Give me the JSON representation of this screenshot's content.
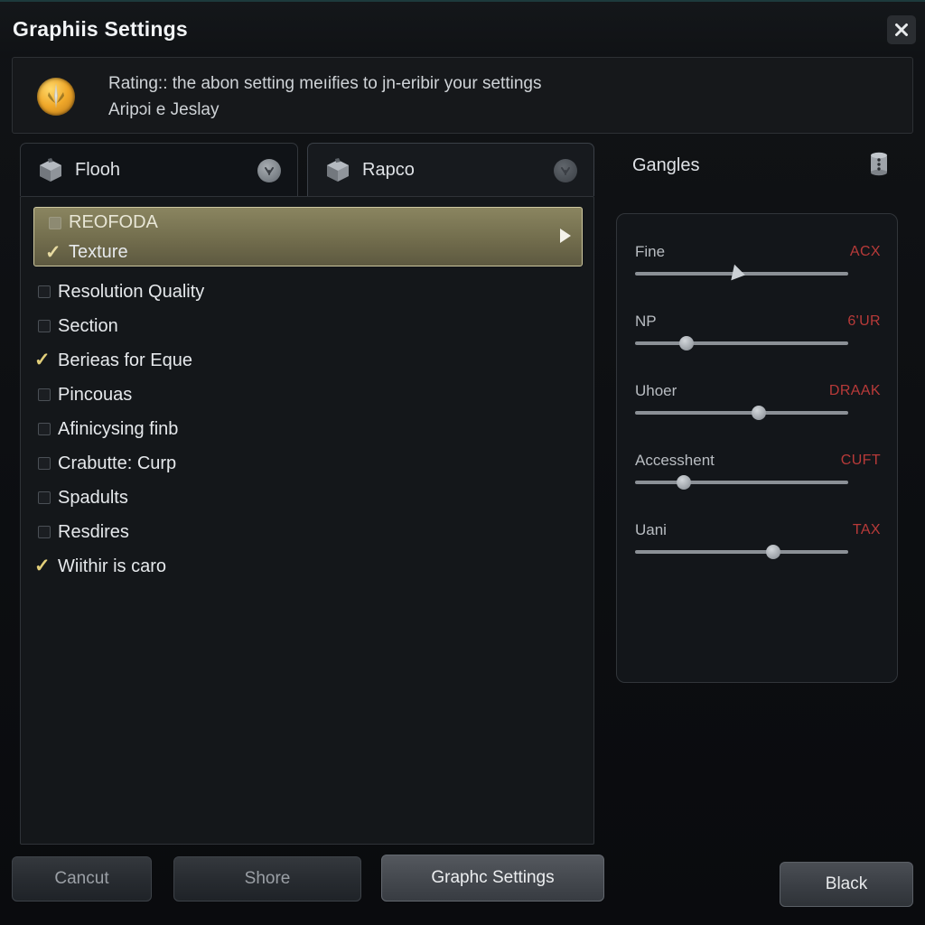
{
  "window": {
    "title": "Graphiis Settings",
    "close_icon": "close-x-icon"
  },
  "banner": {
    "icon": "gold-medal-icon",
    "line1": "Rating:: the abon setting meıifies to jn-eribir your settings",
    "line2": "Aripɔi e Jeslay"
  },
  "tabs": [
    {
      "label": "Flooh",
      "cube_icon": "cube-box-icon",
      "badge_icon": "circle-chevron-badge-icon",
      "active": true
    },
    {
      "label": "Rapco",
      "cube_icon": "cube-box-icon",
      "badge_icon": "circle-dim-badge-icon",
      "active": false
    }
  ],
  "list": {
    "selected_group": {
      "line1": {
        "label": "REOFODA",
        "checked": false
      },
      "line2": {
        "label": "Texture",
        "checked": true
      },
      "arrow_icon": "chevron-right-icon"
    },
    "items": [
      {
        "label": "Resolution Quality",
        "checked": false
      },
      {
        "label": "Section",
        "checked": false
      },
      {
        "label": "Berieas for Eque",
        "checked": true
      },
      {
        "label": "Pincouas",
        "checked": false
      },
      {
        "label": "Afinicysing finb",
        "checked": false
      },
      {
        "label": "Crabutte: Curp",
        "checked": false
      },
      {
        "label": "Spadults",
        "checked": false
      },
      {
        "label": "Resdires",
        "checked": false
      },
      {
        "label": "Wiithir is caro",
        "checked": true
      }
    ],
    "check_glyph": "✓"
  },
  "right_panel": {
    "title": "Gangles",
    "header_icon": "cylinder-database-icon",
    "sliders": [
      {
        "name": "Fine",
        "value": "ACX",
        "percent": 48,
        "knob": "arrow"
      },
      {
        "name": "NP",
        "value": "6'UR",
        "percent": 24,
        "knob": "round"
      },
      {
        "name": "Uhoer",
        "value": "DRAAK",
        "percent": 58,
        "knob": "round"
      },
      {
        "name": "Accesshent",
        "value": "CUFT",
        "percent": 23,
        "knob": "round"
      },
      {
        "name": "Uani",
        "value": "TAX",
        "percent": 65,
        "knob": "round"
      }
    ]
  },
  "footer": {
    "buttons": [
      {
        "label": "Cancut"
      },
      {
        "label": "Shore"
      },
      {
        "label": "Graphc Settings"
      },
      {
        "label": "Black"
      }
    ]
  },
  "colors": {
    "accent_highlight": "#8a8560",
    "check_gold": "#e2cf7a",
    "slider_value_red": "#b83a39",
    "panel_bg": "#14171a",
    "window_bg": "#0d0f12"
  }
}
